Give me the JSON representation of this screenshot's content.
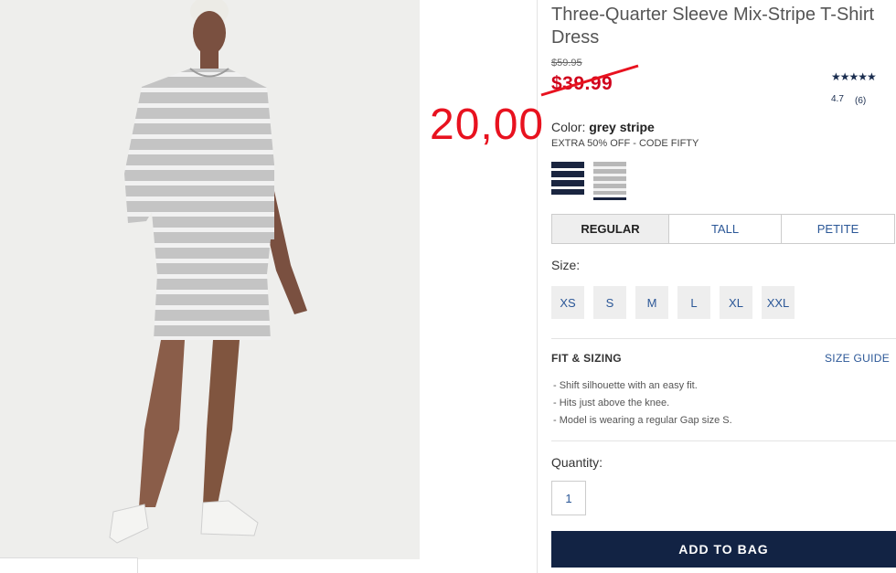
{
  "product": {
    "title": "Three-Quarter Sleeve Mix-Stripe T-Shirt Dress",
    "original_price": "$59.95",
    "sale_price": "$39.99",
    "annotation_price": "20,00",
    "rating": {
      "stars": "★★★★★",
      "score": "4.7",
      "count": "(6)"
    }
  },
  "color": {
    "label": "Color:",
    "selected": "grey stripe",
    "promo": "EXTRA 50% OFF - CODE FIFTY",
    "swatches": [
      "navy stripe",
      "grey stripe"
    ]
  },
  "fit_tabs": [
    {
      "label": "REGULAR",
      "active": true
    },
    {
      "label": "TALL",
      "active": false
    },
    {
      "label": "PETITE",
      "active": false
    }
  ],
  "size": {
    "label": "Size:",
    "options": [
      "XS",
      "S",
      "M",
      "L",
      "XL",
      "XXL"
    ]
  },
  "fit_sizing": {
    "heading": "FIT & SIZING",
    "guide_link": "SIZE GUIDE",
    "bullets": [
      "- Shift silhouette with an easy fit.",
      "- Hits just above the knee.",
      "- Model is wearing a regular Gap size S."
    ]
  },
  "quantity": {
    "label": "Quantity:",
    "value": "1"
  },
  "cta": {
    "add_to_bag": "ADD TO BAG"
  },
  "colors": {
    "accent_navy": "#122344",
    "sale_red": "#d0021b",
    "link_blue": "#2b5797"
  }
}
